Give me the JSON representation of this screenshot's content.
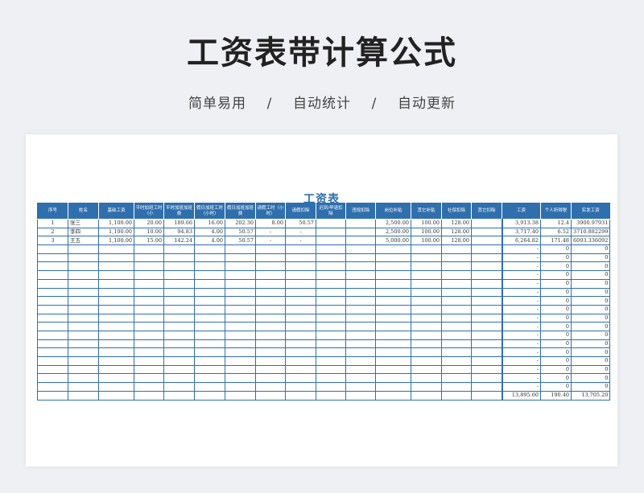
{
  "header": {
    "title": "工资表带计算公式",
    "subtitle": "简单易用    /    自动统计    /    自动更新"
  },
  "sheet": {
    "title": "工资表",
    "columns": [
      "序号",
      "姓名",
      "基础工资",
      "平时加班工时（小",
      "平时加班加班费",
      "假日加班工时（小时）",
      "假日加班加班费",
      "请假工时（小时）",
      "请假扣除",
      "迟到/早退扣除",
      "违规扣除",
      "岗位补贴",
      "其它补贴",
      "社保扣除",
      "其它扣除",
      "工资",
      "个人所得税",
      "实发工资"
    ],
    "rows": [
      {
        "no": "1",
        "name": "张三",
        "base": "1,100.00",
        "ot_hours": "20.00",
        "ot_pay": "189.66",
        "hol_hours": "16.00",
        "hol_pay": "202.30",
        "leave_hours": "8.00",
        "leave_deduct": "50.57",
        "late_deduct": "",
        "viol_deduct": "",
        "post_sub": "2,500.00",
        "other_sub": "100.00",
        "social": "128.00",
        "other_deduct": "",
        "wage": "3,913.38",
        "tax": "12.4",
        "net": "3900.97931"
      },
      {
        "no": "2",
        "name": "李四",
        "base": "1,100.00",
        "ot_hours": "10.00",
        "ot_pay": "94.83",
        "hol_hours": "4.00",
        "hol_pay": "50.57",
        "leave_hours": "-",
        "leave_deduct": "-",
        "late_deduct": "",
        "viol_deduct": "",
        "post_sub": "2,500.00",
        "other_sub": "100.00",
        "social": "128.00",
        "other_deduct": "",
        "wage": "3,717.40",
        "tax": "6.52",
        "net": "3710.882299"
      },
      {
        "no": "3",
        "name": "王五",
        "base": "1,100.00",
        "ot_hours": "15.00",
        "ot_pay": "142.24",
        "hol_hours": "4.00",
        "hol_pay": "50.57",
        "leave_hours": "-",
        "leave_deduct": "-",
        "late_deduct": "",
        "viol_deduct": "",
        "post_sub": "5,000.00",
        "other_sub": "100.00",
        "social": "128.00",
        "other_deduct": "",
        "wage": "6,264.82",
        "tax": "171.48",
        "net": "6093.336092"
      }
    ],
    "empty_rows": {
      "wage": "-",
      "tax": "0",
      "net": "0",
      "count": 17
    },
    "totals": {
      "wage": "13,895.60",
      "tax": "190.40",
      "net": "13,705.20"
    }
  }
}
